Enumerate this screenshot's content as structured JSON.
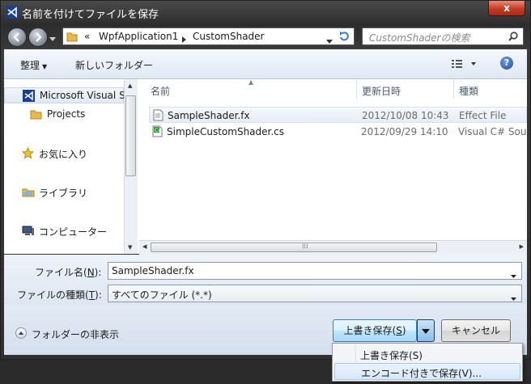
{
  "window": {
    "title": "名前を付けてファイルを保存",
    "close_label": "x"
  },
  "navbar": {
    "overflow": "«",
    "crumbs": [
      "WpfApplication1",
      "CustomShader"
    ],
    "search_placeholder": "CustomShaderの検索"
  },
  "toolbar": {
    "organize": "整理",
    "new_folder": "新しいフォルダー",
    "help": "?"
  },
  "nav_pane": {
    "items": [
      {
        "label": "Microsoft Visual S",
        "icon": "visual-studio-icon"
      },
      {
        "label": "Projects",
        "icon": "folder-icon"
      },
      {
        "label": "お気に入り",
        "icon": "star-icon"
      },
      {
        "label": "ライブラリ",
        "icon": "library-icon"
      },
      {
        "label": "コンピューター",
        "icon": "computer-icon"
      }
    ]
  },
  "file_list": {
    "columns": [
      "名前",
      "更新日時",
      "種類"
    ],
    "rows": [
      {
        "name": "SampleShader.fx",
        "modified": "2012/10/08 10:43",
        "type": "Effect File",
        "icon": "text-file-icon"
      },
      {
        "name": "SimpleCustomShader.cs",
        "modified": "2012/09/29 14:10",
        "type": "Visual C# Sou",
        "icon": "csharp-file-icon"
      }
    ]
  },
  "form": {
    "filename_label": "ファイル名(",
    "filename_key": "N",
    "filename_label_end": "):",
    "filename_value": "SampleShader.fx",
    "filetype_label": "ファイルの種類(",
    "filetype_key": "T",
    "filetype_label_end": "):",
    "filetype_value": "すべてのファイル (*.*)"
  },
  "footer": {
    "hide_folders": "フォルダーの非表示",
    "save_label": "上書き保存(",
    "save_key": "S",
    "save_label_end": ")",
    "cancel": "キャンセル"
  },
  "menu": {
    "items": [
      "上書き保存(S)",
      "エンコード付きで保存(V)..."
    ]
  },
  "colors": {
    "accent": "#3c7fb1",
    "title_bar": "#2d2d2d",
    "close": "#c43b23"
  }
}
